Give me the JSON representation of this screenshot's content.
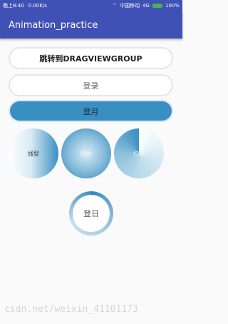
{
  "statusbar": {
    "time": "晚上8:40",
    "network_speed": "0.00K/s",
    "carrier": "中国移动",
    "network_type": "4G",
    "battery": "100%"
  },
  "appbar": {
    "title": "Animation_practice"
  },
  "buttons": {
    "drag_label": "跳转到DRAGVIEWGROUP",
    "login_label": "登录",
    "moon_label": "登月"
  },
  "circles": {
    "linear_label": "线型",
    "radial_label": "放射",
    "sweep_label": "扫描"
  },
  "sun_button": {
    "label": "登日"
  },
  "watermark": "csdn.net/weixin_41101173"
}
